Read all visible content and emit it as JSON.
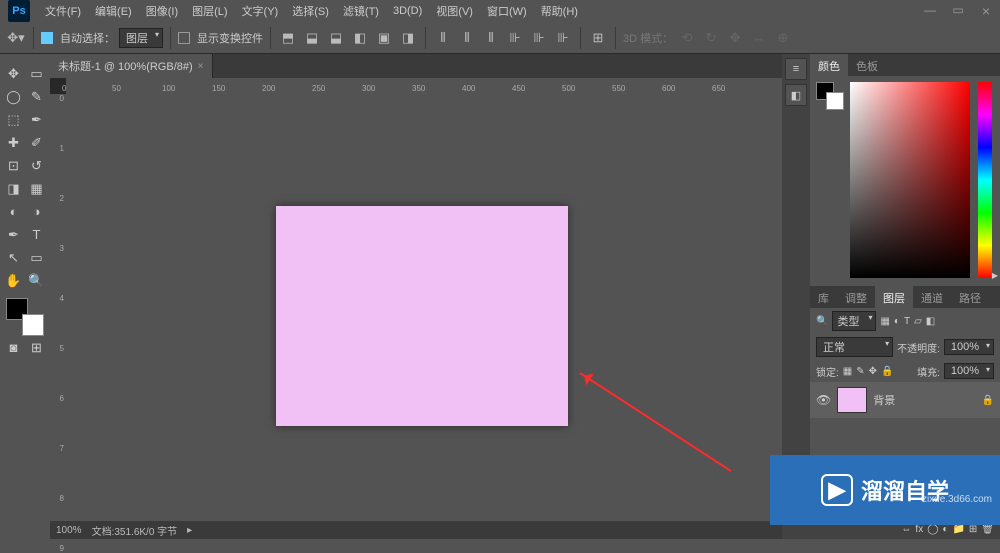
{
  "menu": [
    "文件(F)",
    "编辑(E)",
    "图像(I)",
    "图层(L)",
    "文字(Y)",
    "选择(S)",
    "滤镜(T)",
    "3D(D)",
    "视图(V)",
    "窗口(W)",
    "帮助(H)"
  ],
  "opt": {
    "auto_select": "自动选择：",
    "layer": "图层",
    "show_ctrl": "显示变换控件",
    "mode3d": "3D 模式："
  },
  "tab": {
    "title": "未标题-1 @ 100%(RGB/8#)",
    "close": "×"
  },
  "ruler_h": [
    "0",
    "50",
    "100",
    "150",
    "200",
    "250",
    "300",
    "350",
    "400",
    "450",
    "500",
    "550",
    "600",
    "650"
  ],
  "ruler_v": [
    "0",
    "1",
    "2",
    "3",
    "4",
    "5",
    "6",
    "7",
    "8",
    "9"
  ],
  "tools": [
    "✥",
    "▭",
    "◯",
    "✎",
    "⬚",
    "✂",
    "✒",
    "✐",
    "◧",
    "◐",
    "✎",
    "▦",
    "◑",
    "▤",
    "T",
    "↖",
    "✋",
    "◌",
    "Q",
    "⊞",
    "⊡"
  ],
  "panel_col": [
    "≡",
    "◧"
  ],
  "tabs_color": [
    "颜色",
    "色板"
  ],
  "tabs_layer": [
    "库",
    "调整",
    "图层",
    "通道",
    "路径"
  ],
  "layers": {
    "kind_label": "类型",
    "blend": "正常",
    "opacity_label": "不透明度:",
    "opacity": "100%",
    "lock_label": "锁定:",
    "fill_label": "填充:",
    "fill": "100%",
    "layer_name": "背景"
  },
  "status": {
    "zoom": "100%",
    "doc": "文档:351.6K/0 字节"
  },
  "wm": {
    "text": "溜溜自学",
    "url": "zixue.3d66.com"
  }
}
